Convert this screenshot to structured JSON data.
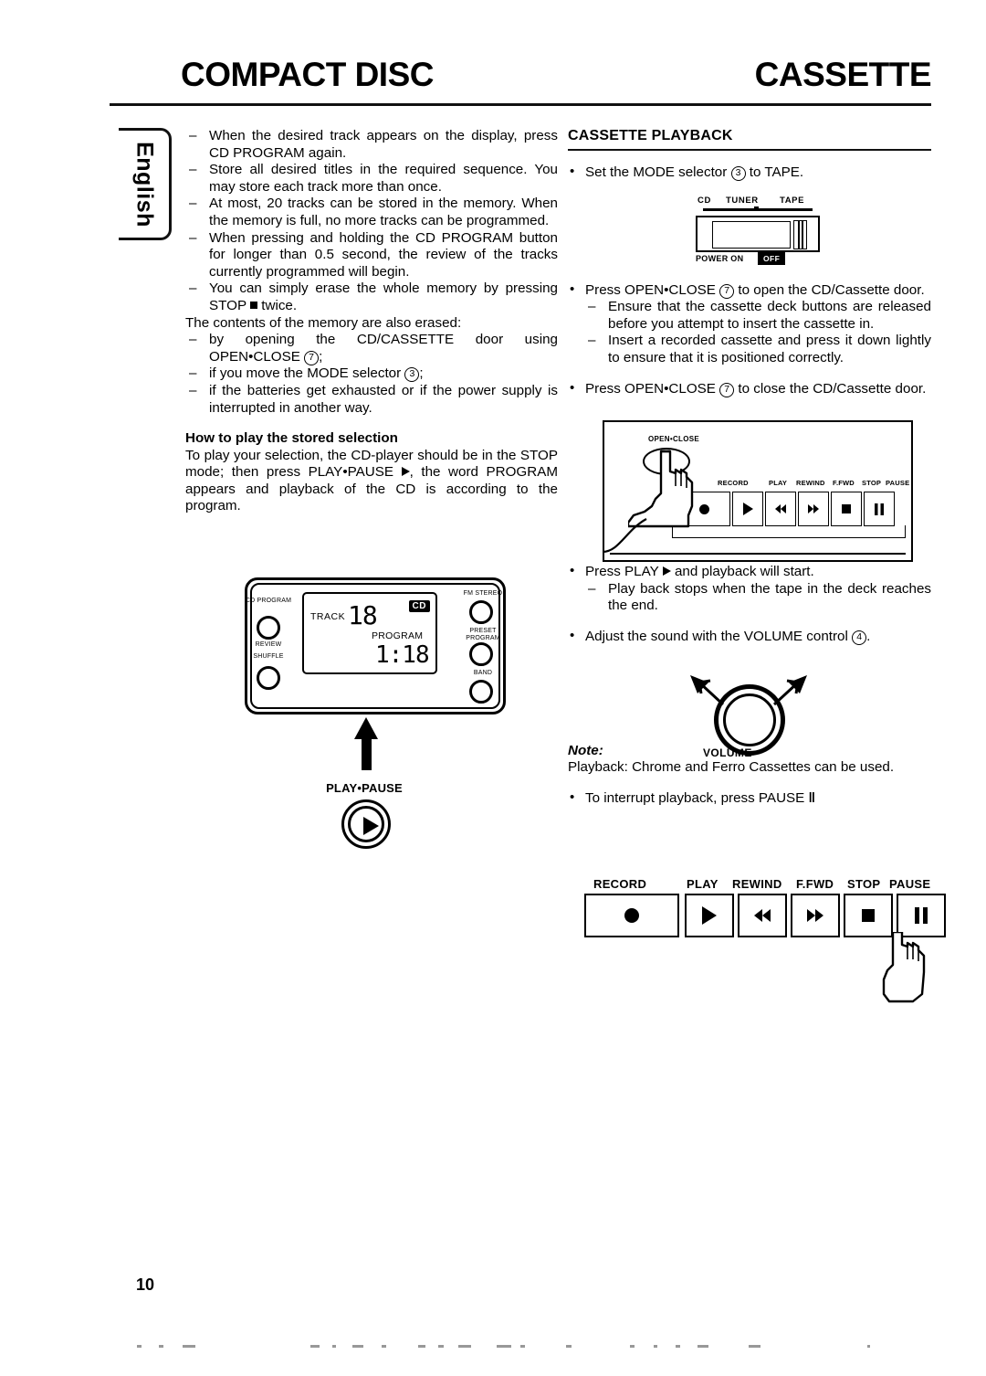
{
  "header": {
    "left_title": "COMPACT DISC",
    "right_title": "CASSETTE"
  },
  "language_tab": {
    "label": "English"
  },
  "page_number": "10",
  "left_column": {
    "cd_program_items": [
      "When the desired track appears on the display, press CD PROGRAM again.",
      "Store all desired titles in the required sequence. You may store each track more than once.",
      "At most, 20 tracks can be stored in the memory. When the memory is full, no more tracks can be programmed.",
      "When pressing and holding the CD PROGRAM button for longer than 0.5 second, the review of the tracks currently programmed will begin."
    ],
    "erase_item_pre": "You can simply erase the whole memory by pressing STOP",
    "erase_item_post": "twice.",
    "memory_erased_intro": "The contents of the memory are also erased:",
    "erased_items": [
      {
        "pre": "by opening the CD/CASSETTE door using OPEN•CLOSE",
        "circle": "7",
        "post": ";"
      },
      {
        "pre": "if you move the MODE selector",
        "circle": "3",
        "post": ";"
      },
      {
        "pre": "if the batteries get exhausted or if the power supply is interrupted in another way.",
        "circle": "",
        "post": ""
      }
    ],
    "how_to_play_heading": "How to play the stored selection",
    "how_to_play_part1": "To play your selection, the CD-player should be in the STOP mode; then press PLAY•PAUSE",
    "how_to_play_part2": ", the word PROGRAM appears and playback of the CD is according to the program."
  },
  "cd_panel": {
    "display": {
      "track_label": "TRACK",
      "track_value": "18",
      "cd_badge": "CD",
      "program_label": "PROGRAM",
      "time_value": "1:18"
    },
    "left_buttons": [
      {
        "label_top": "CD PROGRAM",
        "label_bottom": "REVIEW"
      },
      {
        "label_top": "SHUFFLE",
        "label_bottom": ""
      }
    ],
    "right_buttons": [
      {
        "label": "FM STEREO"
      },
      {
        "label": "PRESET PROGRAM"
      },
      {
        "label": "BAND"
      }
    ],
    "play_pause_label": "PLAY•PAUSE"
  },
  "right_column": {
    "section_title": "CASSETTE PLAYBACK",
    "mode_bullet_pre": "Set the MODE selector",
    "mode_bullet_circle": "3",
    "mode_bullet_post": "to TAPE.",
    "mode_selector_diagram": {
      "positions": [
        "CD",
        "TUNER",
        "TAPE"
      ],
      "power_label": "POWER ON",
      "off_label": "OFF"
    },
    "open_bullet_pre": "Press OPEN•CLOSE",
    "open_bullet_circle": "7",
    "open_bullet_post": "to open the CD/Cassette door.",
    "open_subitems": [
      "Ensure that the cassette deck buttons are released before you attempt to insert the cassette in.",
      "Insert a recorded cassette and press it down lightly to ensure that it is positioned correctly."
    ],
    "close_bullet_pre": "Press OPEN•CLOSE",
    "close_bullet_circle": "7",
    "close_bullet_post": "to close the CD/Cassette door.",
    "deck_diagram": {
      "open_close_label": "OPEN•CLOSE",
      "buttons": [
        "RECORD",
        "PLAY",
        "REWIND",
        "F.FWD",
        "STOP",
        "PAUSE"
      ]
    },
    "play_bullet_pre": "Press PLAY",
    "play_bullet_post": "and playback will start.",
    "play_subitem": "Play back stops when the tape in the deck reaches the end.",
    "volume_bullet_pre": "Adjust the sound with the VOLUME control",
    "volume_bullet_circle": "4",
    "volume_bullet_post": ".",
    "volume_diagram_label": "VOLUME",
    "note_heading": "Note:",
    "note_text": "Playback: Chrome and Ferro Cassettes can be used.",
    "pause_bullet_pre": "To interrupt playback, press PAUSE",
    "pause_bullet_post": "",
    "button_row": {
      "labels": [
        "RECORD",
        "PLAY",
        "REWIND",
        "F.FWD",
        "STOP",
        "PAUSE"
      ],
      "icons": [
        "record-dot-icon",
        "play-triangle-icon",
        "rewind-icon",
        "fast-forward-icon",
        "stop-square-icon",
        "pause-bars-icon"
      ]
    }
  }
}
